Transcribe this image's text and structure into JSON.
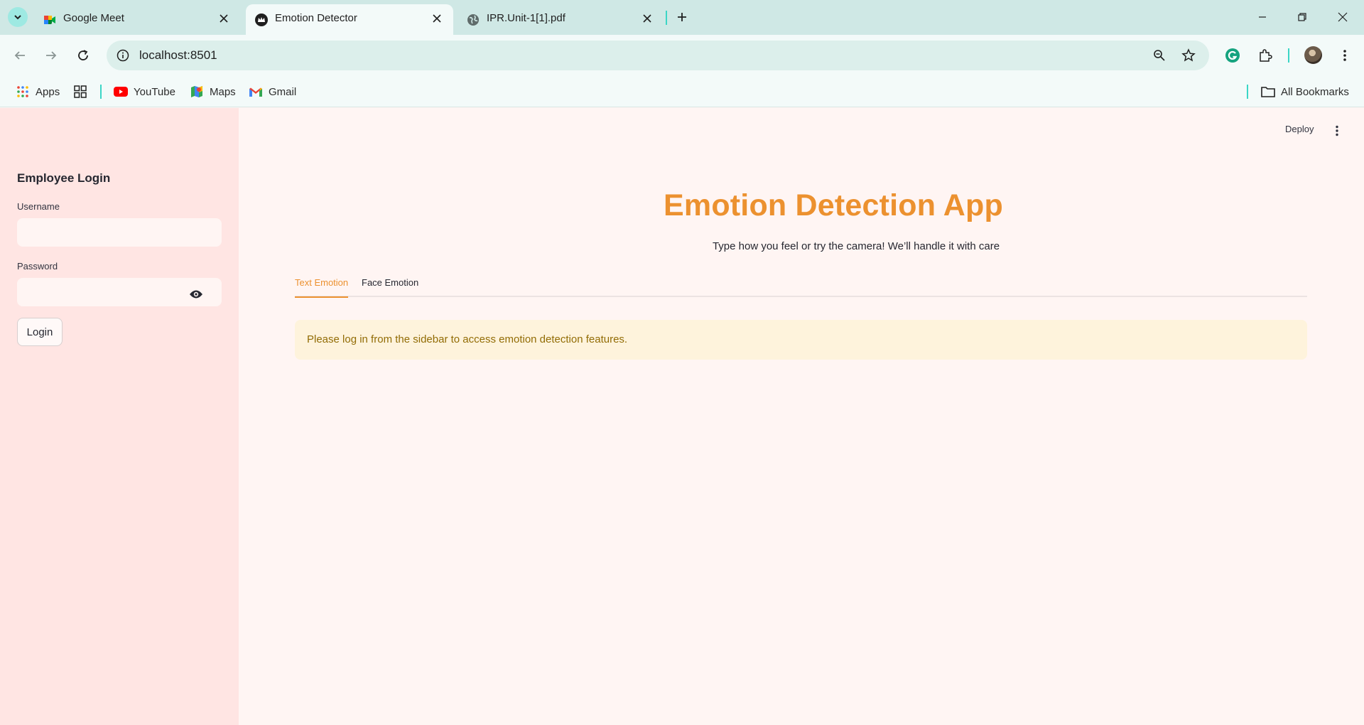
{
  "browser": {
    "tabs": [
      {
        "title": "Google Meet",
        "icon": "google-meet-icon",
        "active": false
      },
      {
        "title": "Emotion Detector",
        "icon": "streamlit-crown-icon",
        "active": true
      },
      {
        "title": "IPR.Unit-1[1].pdf",
        "icon": "globe-icon",
        "active": false
      }
    ],
    "url": "localhost:8501",
    "bookmarks": [
      {
        "label": "Apps",
        "icon": "apps-grid-icon"
      },
      {
        "label": "",
        "icon": "tab-groups-icon"
      },
      {
        "label": "YouTube",
        "icon": "youtube-icon"
      },
      {
        "label": "Maps",
        "icon": "maps-icon"
      },
      {
        "label": "Gmail",
        "icon": "gmail-icon"
      }
    ],
    "all_bookmarks": "All Bookmarks",
    "accent_color": "#3bd6c6"
  },
  "sidebar": {
    "title": "Employee Login",
    "username_label": "Username",
    "username_value": "",
    "password_label": "Password",
    "password_value": "",
    "login_button": "Login"
  },
  "main": {
    "deploy_label": "Deploy",
    "title": "Emotion Detection App",
    "subtitle": "Type how you feel or try the camera! We’ll handle it with care",
    "tabs": [
      {
        "label": "Text Emotion",
        "active": true
      },
      {
        "label": "Face Emotion",
        "active": false
      }
    ],
    "alert": "Please log in from the sidebar to access emotion detection features.",
    "title_color": "#ec912f",
    "alert_bg": "#fef3dc"
  }
}
